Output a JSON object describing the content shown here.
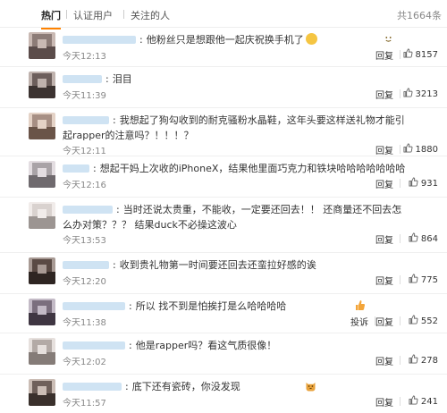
{
  "tabs": [
    "热门",
    "认证用户",
    "关注的人"
  ],
  "total_count": "共1664条",
  "actions": {
    "reply": "回复",
    "report": "投诉"
  },
  "colors": {
    "accent": "#ff8200",
    "link_blur": "#cfe3f3",
    "meta": "#888888"
  },
  "comments": [
    {
      "text": "他粉丝只是想跟他一起庆祝换手机了",
      "emoji": "smile-face",
      "time": "今天12:13",
      "likes": "8157"
    },
    {
      "text": "泪目",
      "emoji": null,
      "time": "今天11:39",
      "likes": "3213"
    },
    {
      "text": "我想起了狗勾收到的耐克骚粉水晶鞋，这年头要这样送礼物才能引起rapper的注意吗？！！！？",
      "emoji": null,
      "time": "今天12:11",
      "likes": "1880"
    },
    {
      "text": "想起干妈上次收的iPhoneX，结果他里面巧克力和铁块哈哈哈哈哈哈哈",
      "emoji": null,
      "time": "今天12:16",
      "likes": "931"
    },
    {
      "text": "当时还说太贵重，不能收，一定要还回去！！ 还商量还不回去怎么办对策？？？ 结果duck不必操这波心",
      "emoji": null,
      "time": "今天13:53",
      "likes": "864"
    },
    {
      "text": "收到贵礼物第一时间要还回去还蛮拉好感的诶",
      "emoji": null,
      "time": "今天12:20",
      "likes": "775"
    },
    {
      "text": "所以 找不到是怕挨打是么哈哈哈哈",
      "emoji": "thumb",
      "time": "今天11:38",
      "likes": "552",
      "report": true
    },
    {
      "text": "他是rapper吗？看这气质很像！",
      "emoji": null,
      "time": "今天12:02",
      "likes": "278"
    },
    {
      "text": "底下还有瓷砖，你没发现",
      "emoji": "cat-face",
      "time": "今天11:57",
      "likes": "241"
    }
  ]
}
